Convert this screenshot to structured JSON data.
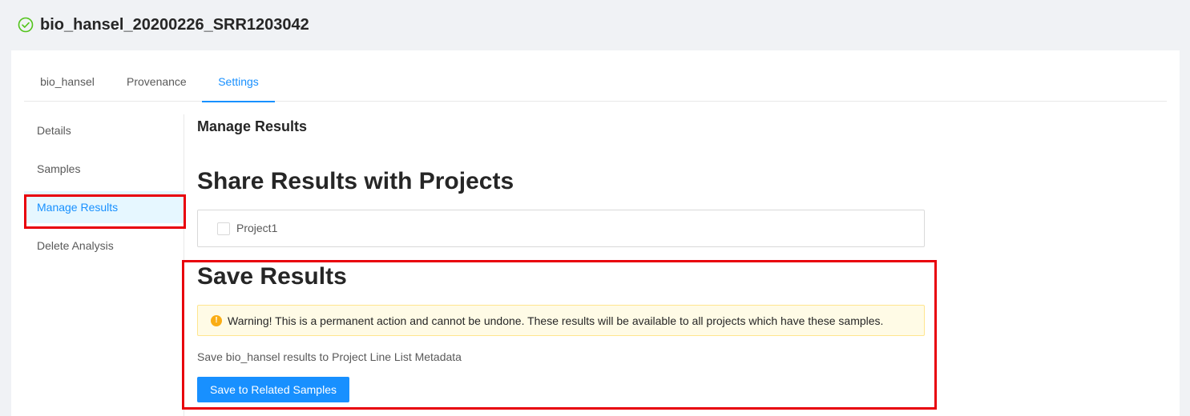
{
  "header": {
    "title": "bio_hansel_20200226_SRR1203042",
    "status_icon": "check-circle-icon",
    "status_color": "#52c41a"
  },
  "tabs": [
    {
      "label": "bio_hansel",
      "active": false
    },
    {
      "label": "Provenance",
      "active": false
    },
    {
      "label": "Settings",
      "active": true
    }
  ],
  "sidebar": {
    "items": [
      {
        "label": "Details",
        "active": false
      },
      {
        "label": "Samples",
        "active": false
      },
      {
        "label": "Manage Results",
        "active": true
      },
      {
        "label": "Delete Analysis",
        "active": false
      }
    ]
  },
  "main": {
    "heading": "Manage Results",
    "share_heading": "Share Results with Projects",
    "projects": [
      {
        "label": "Project1",
        "checked": false
      }
    ],
    "save_heading": "Save Results",
    "warning": {
      "icon": "exclamation-circle-icon",
      "text": "Warning! This is a permanent action and cannot be undone. These results will be available to all projects which have these samples."
    },
    "save_description": "Save bio_hansel results to Project Line List Metadata",
    "save_button": "Save to Related Samples"
  },
  "colors": {
    "accent": "#1890ff",
    "highlight": "#e8000b",
    "warning": "#faad14"
  }
}
